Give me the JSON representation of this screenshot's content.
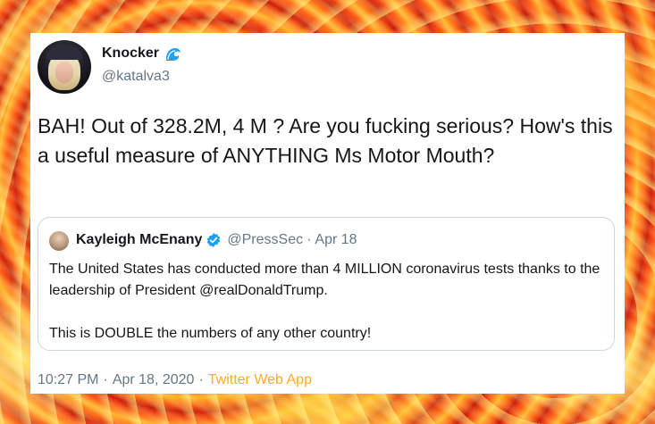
{
  "tweet": {
    "display_name": "Knocker",
    "name_emoji_icon": "wave-icon",
    "handle": "@katalva3",
    "text": "BAH! Out of 328.2M, 4 M ? Are you fucking serious? How's this a useful measure of ANYTHING Ms Motor Mouth?",
    "footer": {
      "time": "10:27 PM",
      "separator": "·",
      "date": "Apr 18, 2020",
      "source": "Twitter Web App"
    }
  },
  "quoted_tweet": {
    "display_name": "Kayleigh McEnany",
    "verified_icon": "verified-badge-icon",
    "handle": "@PressSec",
    "separator": "·",
    "date": "Apr 18",
    "paragraphs": [
      "The United States has conducted more than 4 MILLION coronavirus tests thanks to the leadership of President @realDonaldTrump.",
      "This is DOUBLE the numbers of any other country!"
    ]
  },
  "colors": {
    "text_primary": "#14171a",
    "text_secondary": "#657786",
    "verified_blue": "#1da1f2",
    "source_link": "#ffad1f",
    "quote_border": "#ccd6dd",
    "background_lava": "#e8410f"
  }
}
